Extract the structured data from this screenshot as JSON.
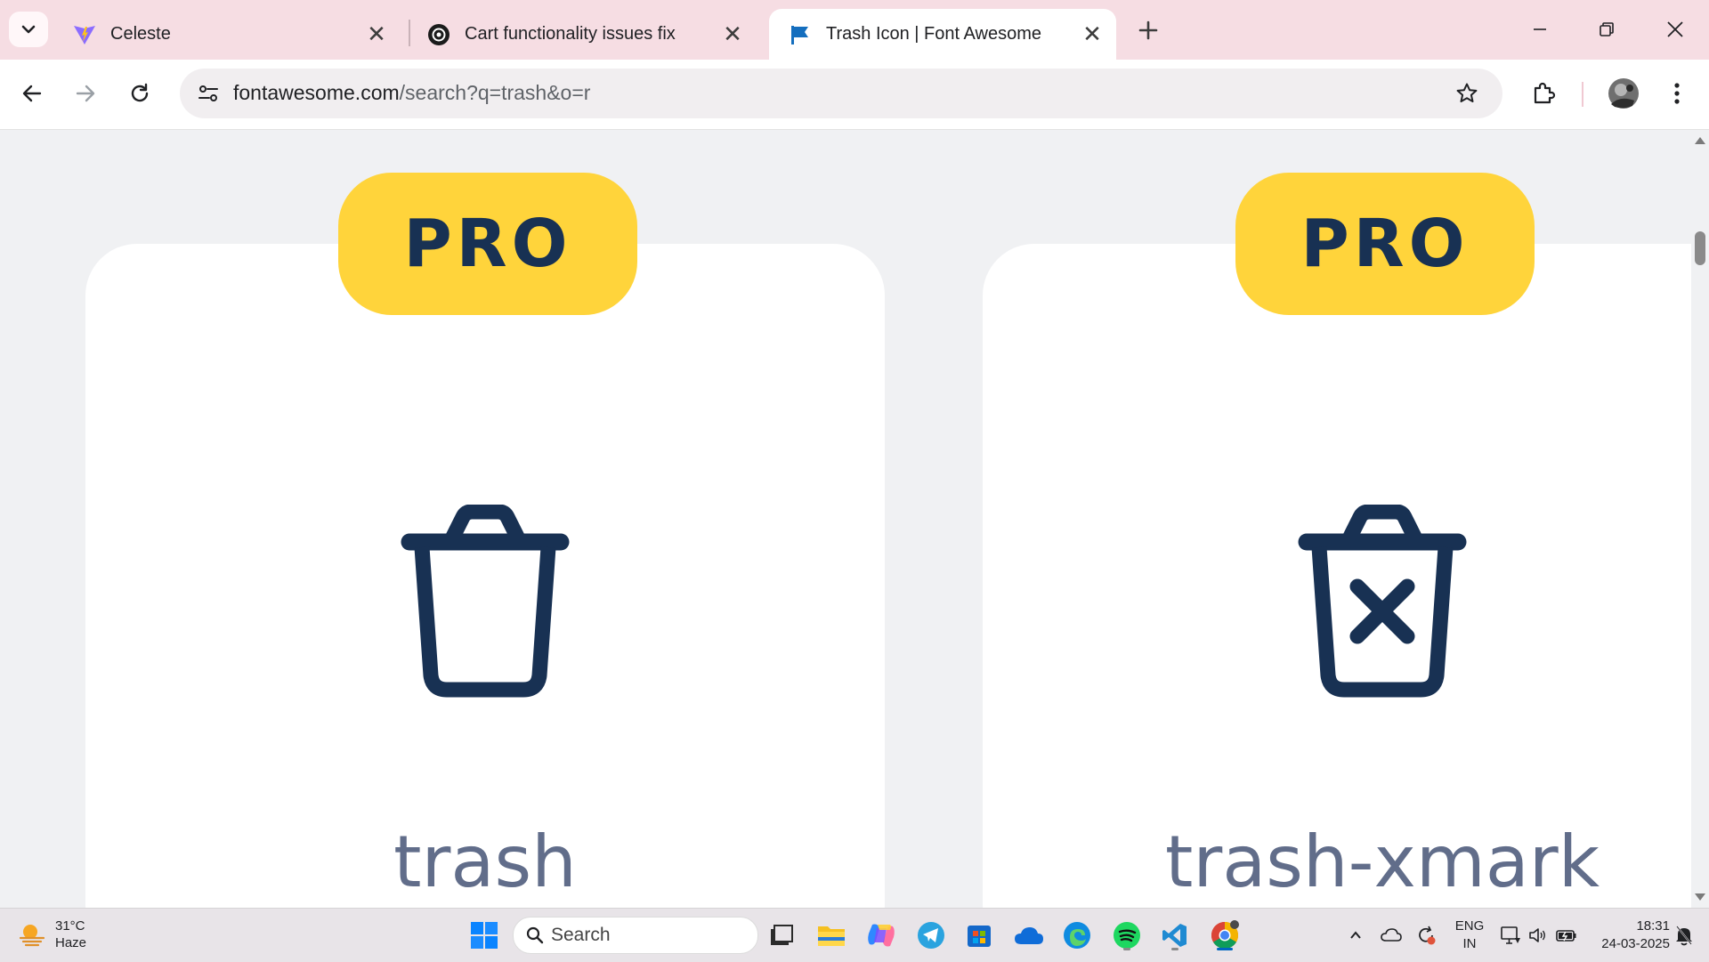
{
  "tabs": [
    {
      "title": "Celeste",
      "icon": "vite-icon"
    },
    {
      "title": "Cart functionality issues fix",
      "icon": "chatgpt-icon"
    },
    {
      "title": "Trash Icon | Font Awesome",
      "icon": "font-awesome-flag-icon",
      "active": true
    }
  ],
  "address_bar": {
    "domain": "fontawesome.com",
    "path": "/search?q=trash&o=r"
  },
  "cards": [
    {
      "badge": "PRO",
      "name": "trash",
      "icon": "trash-icon"
    },
    {
      "badge": "PRO",
      "name": "trash-xmark",
      "icon": "trash-xmark-icon"
    }
  ],
  "taskbar": {
    "weather": {
      "temp": "31°C",
      "condition": "Haze"
    },
    "search_label": "Search",
    "lang": {
      "line1": "ENG",
      "line2": "IN"
    },
    "time": "18:31",
    "date": "24-03-2025"
  },
  "colors": {
    "pro_badge": "#ffd43b",
    "icon_navy": "#183153",
    "tab_strip": "#f6dde3"
  }
}
